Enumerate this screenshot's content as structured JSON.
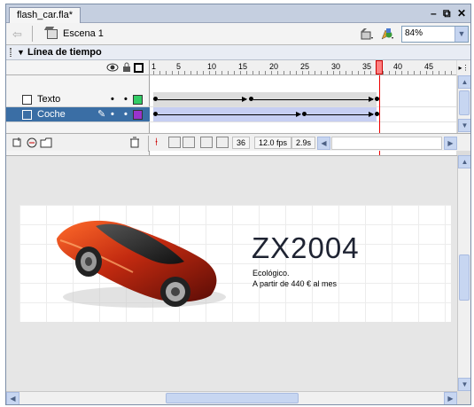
{
  "window": {
    "tab_title": "flash_car.fla*",
    "minimize": "–",
    "restore": "⧉",
    "close": "✕"
  },
  "toolbar": {
    "scene_label": "Escena 1",
    "zoom_value": "84%"
  },
  "timeline": {
    "title": "Línea de tiempo",
    "ruler_numbers": [
      "1",
      "5",
      "10",
      "15",
      "20",
      "25",
      "30",
      "35",
      "40",
      "45"
    ],
    "layers": [
      {
        "name": "Texto",
        "color": "#33cc66",
        "selected": false
      },
      {
        "name": "Coche",
        "color": "#9933cc",
        "selected": true
      }
    ],
    "status": {
      "frame": "36",
      "fps": "12.0 fps",
      "time": "2.9s"
    }
  },
  "stage": {
    "brand": "ZX2004",
    "line1": "Ecológico.",
    "line2": "A partir de 440 € al mes"
  },
  "icons": [
    "back-arrow-icon",
    "scene-icon",
    "edit-scene-icon",
    "edit-symbol-icon",
    "eye-icon",
    "lock-icon",
    "outline-icon",
    "pencil-icon",
    "add-layer-icon",
    "add-guide-icon",
    "add-folder-icon",
    "trash-icon",
    "center-frame-icon",
    "onion-skin-icon",
    "onion-outline-icon",
    "edit-multiple-icon",
    "onion-markers-icon"
  ]
}
